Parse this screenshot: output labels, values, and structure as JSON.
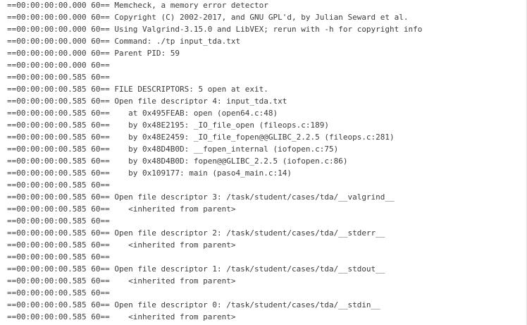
{
  "log": {
    "lines": [
      "==00:00:00:00.000 60== Memcheck, a memory error detector",
      "==00:00:00:00.000 60== Copyright (C) 2002-2017, and GNU GPL'd, by Julian Seward et al.",
      "==00:00:00:00.000 60== Using Valgrind-3.15.0 and LibVEX; rerun with -h for copyright info",
      "==00:00:00:00.000 60== Command: ./tp input_tda.txt",
      "==00:00:00:00.000 60== Parent PID: 59",
      "==00:00:00:00.000 60==",
      "==00:00:00:00.585 60==",
      "==00:00:00:00.585 60== FILE DESCRIPTORS: 5 open at exit.",
      "==00:00:00:00.585 60== Open file descriptor 4: input_tda.txt",
      "==00:00:00:00.585 60==    at 0x495FEAB: open (open64.c:48)",
      "==00:00:00:00.585 60==    by 0x48E2195: _IO_file_open (fileops.c:189)",
      "==00:00:00:00.585 60==    by 0x48E2459: _IO_file_fopen@@GLIBC_2.2.5 (fileops.c:281)",
      "==00:00:00:00.585 60==    by 0x48D4B0D: __fopen_internal (iofopen.c:75)",
      "==00:00:00:00.585 60==    by 0x48D4B0D: fopen@@GLIBC_2.2.5 (iofopen.c:86)",
      "==00:00:00:00.585 60==    by 0x109177: main (paso4_main.c:14)",
      "==00:00:00:00.585 60==",
      "==00:00:00:00.585 60== Open file descriptor 3: /task/student/cases/tda/__valgrind__",
      "==00:00:00:00.585 60==    <inherited from parent>",
      "==00:00:00:00.585 60==",
      "==00:00:00:00.585 60== Open file descriptor 2: /task/student/cases/tda/__stderr__",
      "==00:00:00:00.585 60==    <inherited from parent>",
      "==00:00:00:00.585 60==",
      "==00:00:00:00.585 60== Open file descriptor 1: /task/student/cases/tda/__stdout__",
      "==00:00:00:00.585 60==    <inherited from parent>",
      "==00:00:00:00.585 60==",
      "==00:00:00:00.585 60== Open file descriptor 0: /task/student/cases/tda/__stdin__",
      "==00:00:00:00.585 60==    <inherited from parent>"
    ]
  }
}
